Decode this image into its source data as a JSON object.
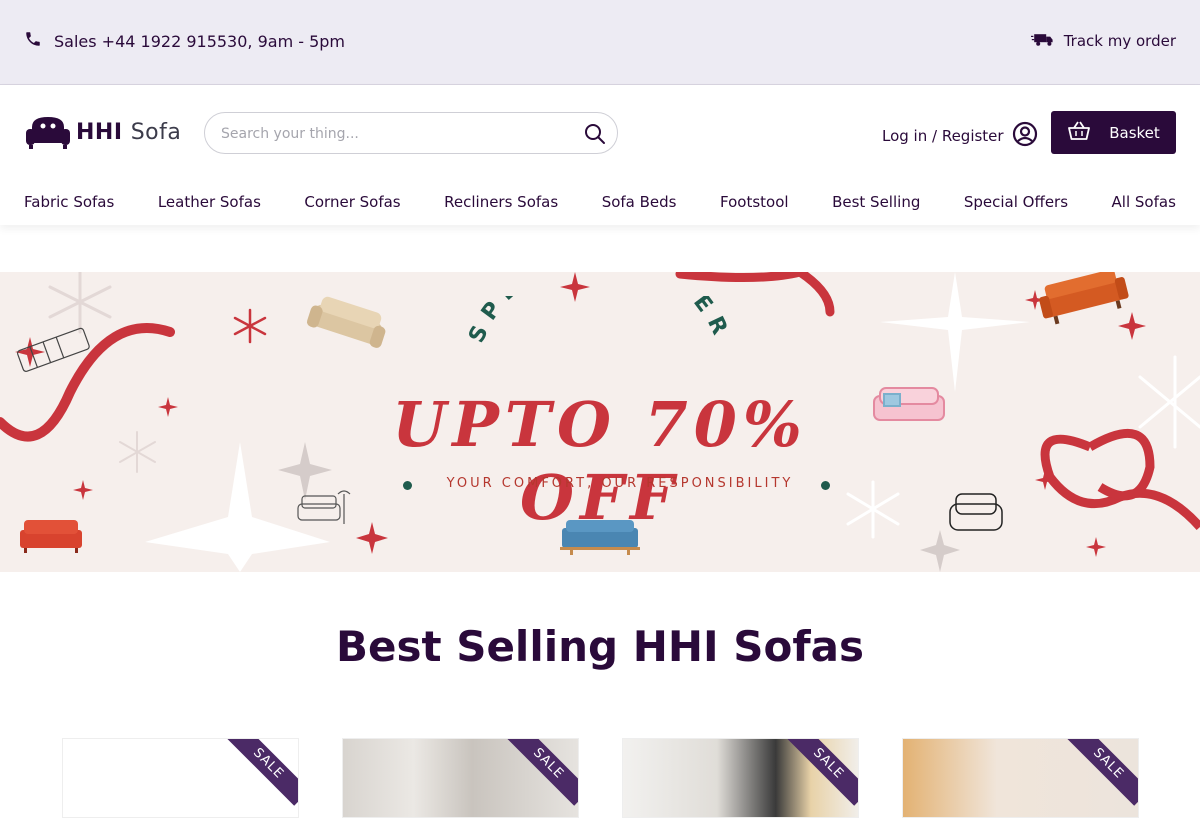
{
  "topbar": {
    "phone_text": "Sales +44 1922 915530, 9am - 5pm",
    "phone_icon": "phone-icon",
    "track_text": "Track my order",
    "track_icon": "truck-icon"
  },
  "header": {
    "logo_bold": "HHI",
    "logo_light": "Sofa",
    "search_placeholder": "Search your thing...",
    "search_icon": "search-icon",
    "login_text": "Log in / Register",
    "login_icon": "user-circle-icon",
    "basket_label": "Basket",
    "basket_icon": "basket-icon"
  },
  "nav": {
    "items": [
      {
        "label": "Fabric Sofas"
      },
      {
        "label": "Leather Sofas"
      },
      {
        "label": "Corner Sofas"
      },
      {
        "label": "Recliners Sofas"
      },
      {
        "label": "Sofa Beds"
      },
      {
        "label": "Footstool"
      },
      {
        "label": "Best Selling"
      },
      {
        "label": "Special Offers"
      },
      {
        "label": "All Sofas"
      }
    ]
  },
  "banner": {
    "arc_text": "SPECIAL OFFER",
    "headline": "UPTO 70% OFF",
    "tagline": "YOUR COMFORT, OUR RESPONSIBILITY"
  },
  "section": {
    "title": "Best Selling HHI Sofas"
  },
  "products": [
    {
      "badge": "SALE"
    },
    {
      "badge": "SALE"
    },
    {
      "badge": "SALE"
    },
    {
      "badge": "SALE"
    }
  ],
  "colors": {
    "brand": "#2a0a3a",
    "topbar_bg": "#edebf3",
    "banner_bg": "#f6efec",
    "offer_red": "#c9353d",
    "ribbon": "#4b2a66"
  }
}
